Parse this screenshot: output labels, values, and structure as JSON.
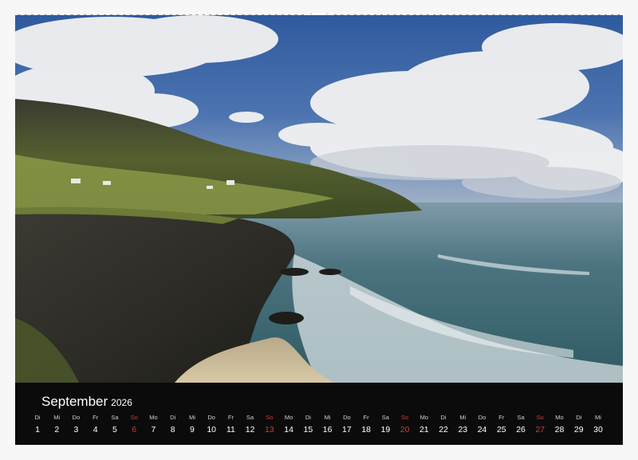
{
  "calendar": {
    "month": "September",
    "year": "2026",
    "days": [
      {
        "dn": "Di",
        "dd": "1",
        "sun": false
      },
      {
        "dn": "Mi",
        "dd": "2",
        "sun": false
      },
      {
        "dn": "Do",
        "dd": "3",
        "sun": false
      },
      {
        "dn": "Fr",
        "dd": "4",
        "sun": false
      },
      {
        "dn": "Sa",
        "dd": "5",
        "sun": false
      },
      {
        "dn": "So",
        "dd": "6",
        "sun": true
      },
      {
        "dn": "Mo",
        "dd": "7",
        "sun": false
      },
      {
        "dn": "Di",
        "dd": "8",
        "sun": false
      },
      {
        "dn": "Mi",
        "dd": "9",
        "sun": false
      },
      {
        "dn": "Do",
        "dd": "10",
        "sun": false
      },
      {
        "dn": "Fr",
        "dd": "11",
        "sun": false
      },
      {
        "dn": "Sa",
        "dd": "12",
        "sun": false
      },
      {
        "dn": "So",
        "dd": "13",
        "sun": true
      },
      {
        "dn": "Mo",
        "dd": "14",
        "sun": false
      },
      {
        "dn": "Di",
        "dd": "15",
        "sun": false
      },
      {
        "dn": "Mi",
        "dd": "16",
        "sun": false
      },
      {
        "dn": "Do",
        "dd": "17",
        "sun": false
      },
      {
        "dn": "Fr",
        "dd": "18",
        "sun": false
      },
      {
        "dn": "Sa",
        "dd": "19",
        "sun": false
      },
      {
        "dn": "So",
        "dd": "20",
        "sun": true
      },
      {
        "dn": "Mo",
        "dd": "21",
        "sun": false
      },
      {
        "dn": "Di",
        "dd": "22",
        "sun": false
      },
      {
        "dn": "Mi",
        "dd": "23",
        "sun": false
      },
      {
        "dn": "Do",
        "dd": "24",
        "sun": false
      },
      {
        "dn": "Fr",
        "dd": "25",
        "sun": false
      },
      {
        "dn": "Sa",
        "dd": "26",
        "sun": false
      },
      {
        "dn": "So",
        "dd": "27",
        "sun": true
      },
      {
        "dn": "Mo",
        "dd": "28",
        "sun": false
      },
      {
        "dn": "Di",
        "dd": "29",
        "sun": false
      },
      {
        "dn": "Mi",
        "dd": "30",
        "sun": false
      }
    ]
  },
  "colors": {
    "sunday": "#d23a3a",
    "strip": "#0b0b0b",
    "sky": "#3f67a8",
    "sea": "#4e7580",
    "cliff": "#3a3a33",
    "grass": "#8a9a4a"
  }
}
